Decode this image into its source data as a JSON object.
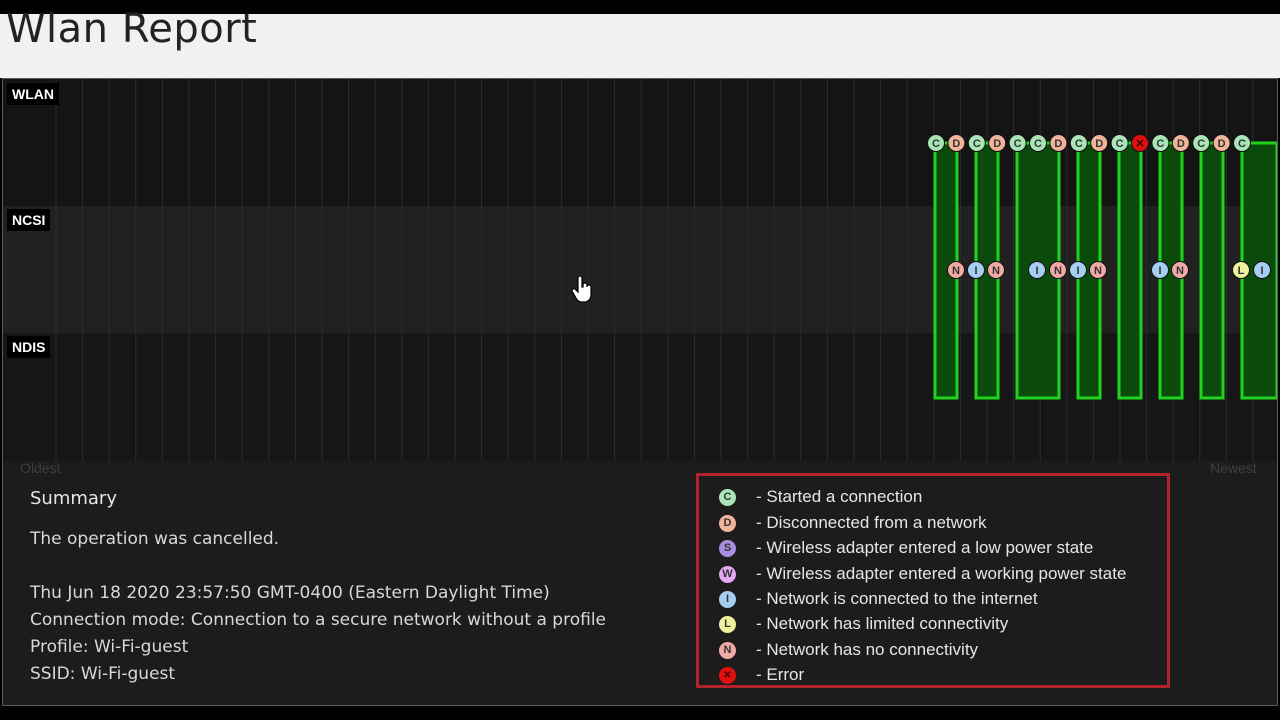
{
  "page": {
    "title": "Wlan Report"
  },
  "lanes": {
    "wlan": "WLAN",
    "ncsi": "NCSI",
    "ndis": "NDIS"
  },
  "axis": {
    "start": "Oldest",
    "end": "Newest"
  },
  "summary": {
    "heading": "Summary",
    "status": "The operation was cancelled.",
    "timestamp": "Thu Jun 18 2020 23:57:50 GMT-0400 (Eastern Daylight Time)",
    "connection_mode": "Connection mode: Connection to a secure network without a profile",
    "profile": "Profile: Wi-Fi-guest",
    "ssid": "SSID: Wi-Fi-guest"
  },
  "legend": {
    "items": [
      {
        "letter": "C",
        "color": "#a9e5b6",
        "text": "- Started a connection"
      },
      {
        "letter": "D",
        "color": "#f1b49a",
        "text": "- Disconnected from a network"
      },
      {
        "letter": "S",
        "color": "#a88ee0",
        "text": "- Wireless adapter entered a low power state"
      },
      {
        "letter": "W",
        "color": "#e2a8f2",
        "text": "- Wireless adapter entered a working power state"
      },
      {
        "letter": "I",
        "color": "#a6cdf2",
        "text": "- Network is connected to the internet"
      },
      {
        "letter": "L",
        "color": "#eff29a",
        "text": "- Network has limited connectivity"
      },
      {
        "letter": "N",
        "color": "#f1a9a6",
        "text": "- Network has no connectivity"
      },
      {
        "letter": "X",
        "color": "#e01010",
        "text": "- Error"
      }
    ]
  },
  "colors": {
    "connection": "#1ed31e",
    "connection_fill": "#0a4a0a",
    "legend_border": "#b3232b"
  },
  "icons": {
    "cursor": "hand-pointer-icon"
  }
}
